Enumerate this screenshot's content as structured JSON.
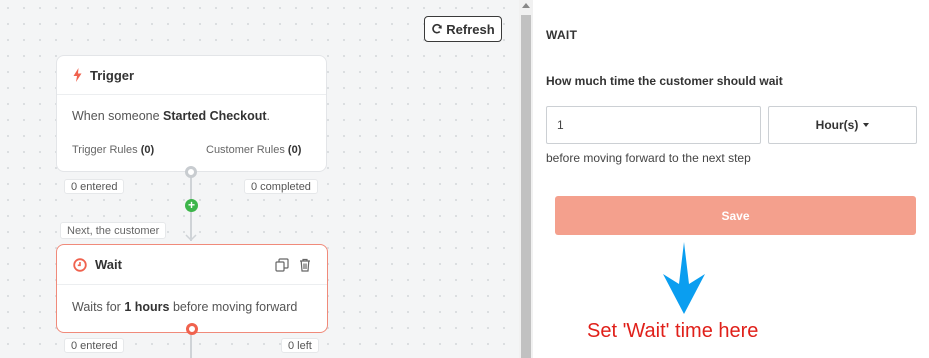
{
  "canvas": {
    "refresh_label": "Refresh",
    "trigger": {
      "title": "Trigger",
      "desc_prefix": "When someone ",
      "desc_event": "Started Checkout",
      "desc_suffix": ".",
      "trigger_rules_label": "Trigger Rules",
      "trigger_rules_count": "(0)",
      "customer_rules_label": "Customer Rules",
      "customer_rules_count": "(0)",
      "entered": "0 entered",
      "completed": "0 completed"
    },
    "next_label": "Next, the customer",
    "wait": {
      "title": "Wait",
      "desc_prefix": "Waits for ",
      "desc_value": "1 hours",
      "desc_suffix": " before moving forward",
      "entered": "0 entered",
      "left": "0 left"
    }
  },
  "panel": {
    "title": "WAIT",
    "question": "How much time the customer should wait",
    "wait_value": "1",
    "unit": "Hour(s)",
    "after_text": "before moving forward to the next step",
    "save_label": "Save"
  },
  "annotation": {
    "text": "Set 'Wait' time here"
  },
  "colors": {
    "accent": "#f0624e",
    "save_button": "#f4a08d",
    "add_node": "#3cb54a",
    "annotation_arrow": "#0a9ef0",
    "annotation_text": "#e0201a"
  },
  "icons": [
    "refresh-icon",
    "bolt-icon",
    "clock-icon",
    "copy-icon",
    "trash-icon",
    "plus-icon",
    "caret-down-icon",
    "arrow-down-icon"
  ]
}
